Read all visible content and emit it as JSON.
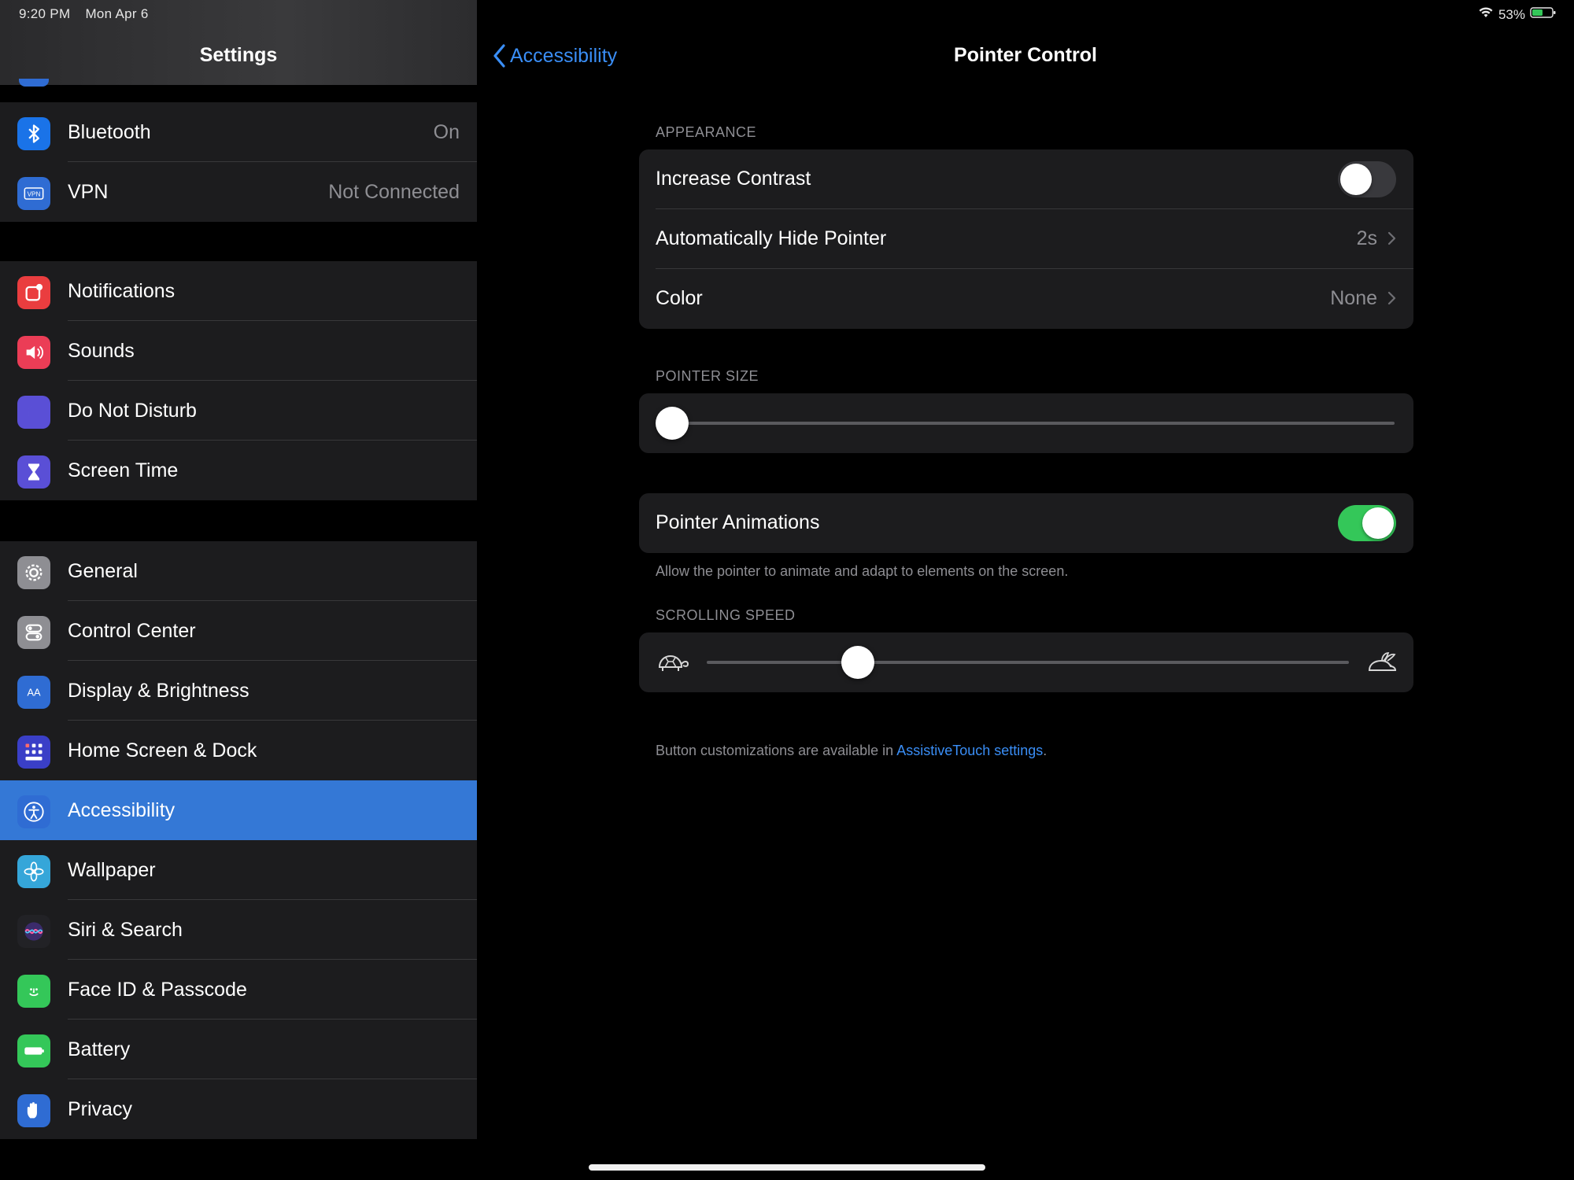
{
  "status": {
    "time": "9:20 PM",
    "date": "Mon Apr 6",
    "battery": "53%"
  },
  "sidebar": {
    "title": "Settings",
    "groups": [
      {
        "items": [
          {
            "label": "Bluetooth",
            "value": "On",
            "icon": "bluetooth-icon",
            "color": "#1a73e8"
          },
          {
            "label": "VPN",
            "value": "Not Connected",
            "icon": "vpn-icon",
            "color": "#2f6cd3"
          }
        ]
      },
      {
        "items": [
          {
            "label": "Notifications",
            "icon": "notifications-icon",
            "color": "#ea3d3f"
          },
          {
            "label": "Sounds",
            "icon": "sounds-icon",
            "color": "#eb3d56"
          },
          {
            "label": "Do Not Disturb",
            "icon": "moon-icon",
            "color": "#5a4fd6"
          },
          {
            "label": "Screen Time",
            "icon": "hourglass-icon",
            "color": "#5a4fd6"
          }
        ]
      },
      {
        "items": [
          {
            "label": "General",
            "icon": "gear-icon",
            "color": "#8e8e93"
          },
          {
            "label": "Control Center",
            "icon": "switches-icon",
            "color": "#8e8e93"
          },
          {
            "label": "Display & Brightness",
            "icon": "text-size-icon",
            "color": "#2f6cd3"
          },
          {
            "label": "Home Screen & Dock",
            "icon": "app-grid-icon",
            "color": "#3a3fc7"
          },
          {
            "label": "Accessibility",
            "icon": "accessibility-icon",
            "color": "#2f6cd3",
            "selected": true
          },
          {
            "label": "Wallpaper",
            "icon": "flower-icon",
            "color": "#35a6d9"
          },
          {
            "label": "Siri & Search",
            "icon": "siri-icon",
            "color": "#222226"
          },
          {
            "label": "Face ID & Passcode",
            "icon": "face-id-icon",
            "color": "#34c759"
          },
          {
            "label": "Battery",
            "icon": "battery-icon",
            "color": "#34c759"
          },
          {
            "label": "Privacy",
            "icon": "hand-icon",
            "color": "#2f6cd3"
          }
        ]
      }
    ]
  },
  "detail": {
    "back_label": "Accessibility",
    "title": "Pointer Control",
    "appearance": {
      "header": "APPEARANCE",
      "increase_contrast": {
        "label": "Increase Contrast",
        "on": false
      },
      "auto_hide": {
        "label": "Automatically Hide Pointer",
        "value": "2s"
      },
      "color": {
        "label": "Color",
        "value": "None"
      }
    },
    "pointer_size": {
      "header": "POINTER SIZE",
      "level": 0.0
    },
    "pointer_animations": {
      "label": "Pointer Animations",
      "on": true,
      "footer": "Allow the pointer to animate and adapt to elements on the screen."
    },
    "scrolling_speed": {
      "header": "SCROLLING SPEED",
      "level": 0.235
    },
    "bottom_note": {
      "text": "Button customizations are available in ",
      "link": "AssistiveTouch settings",
      "end": "."
    }
  },
  "colors": {
    "accent": "#3a8ef6",
    "selected_row": "#3478d6",
    "toggle_on": "#34c759"
  }
}
